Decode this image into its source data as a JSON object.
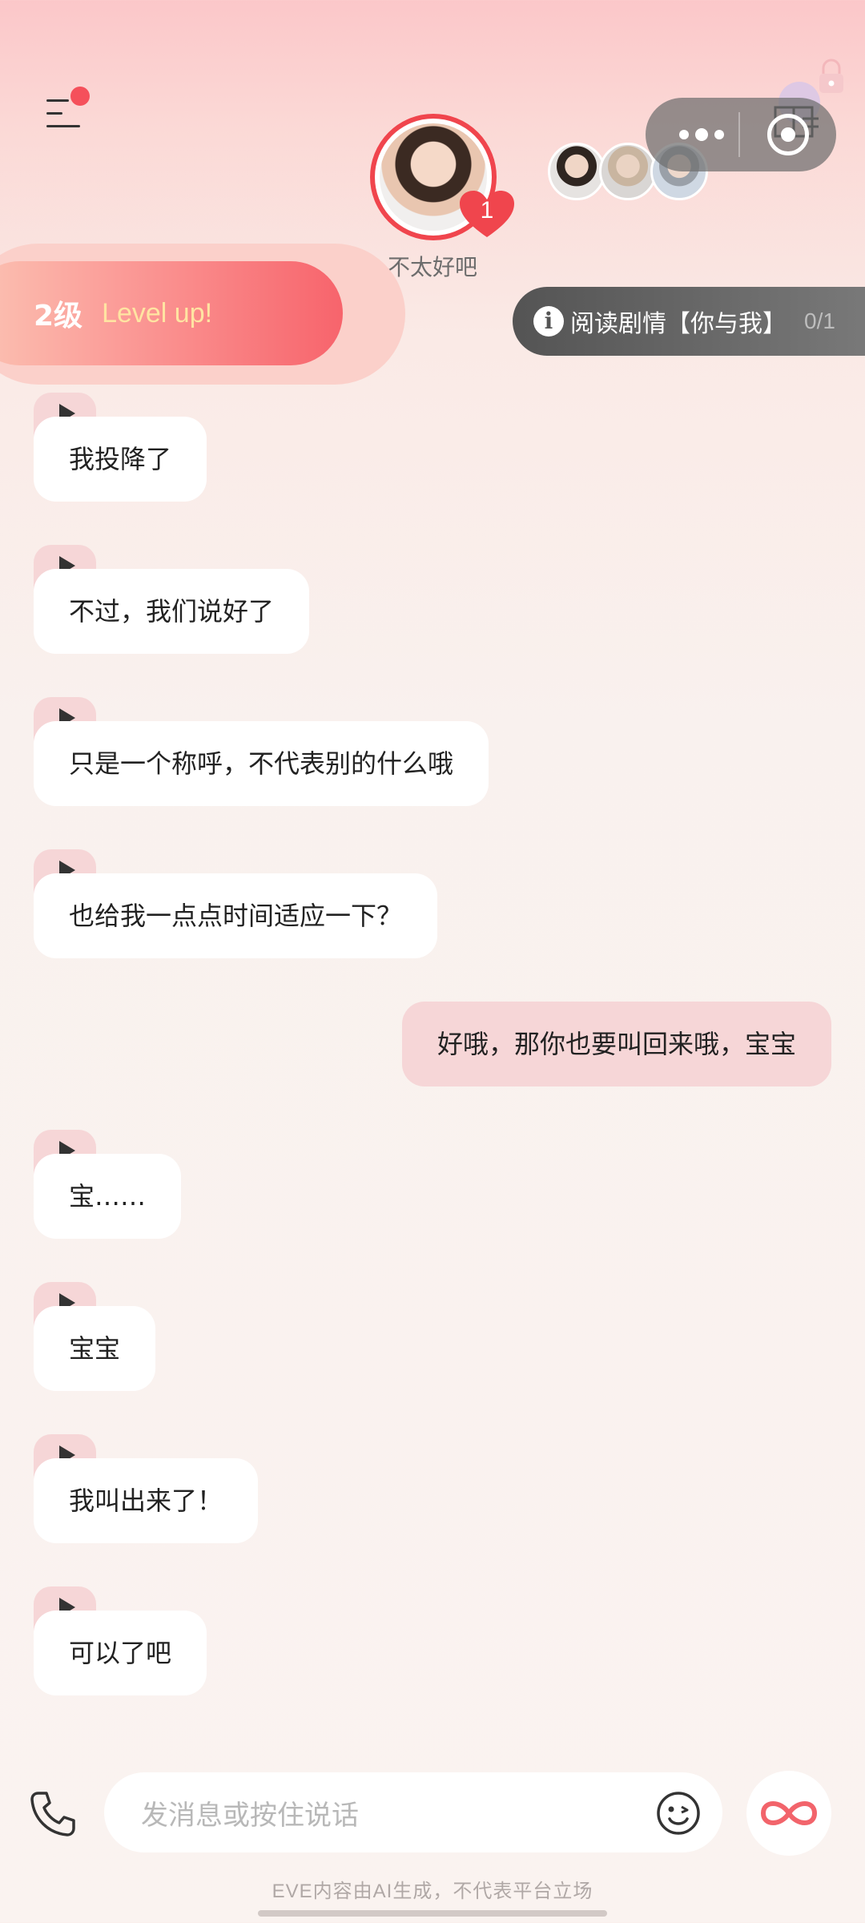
{
  "header": {
    "character_name": "不太好吧",
    "heart_badge_count": "1",
    "menu_icon": "menu-icon",
    "close_icon": "close-icon",
    "more_icon": "more-dots-icon"
  },
  "level_banner": {
    "level": "2级",
    "label": "Level up!"
  },
  "story": {
    "label": "阅读剧情【你与我】",
    "count": "0/1"
  },
  "messages": [
    {
      "from": "ai",
      "text": "我投降了"
    },
    {
      "from": "ai",
      "text": "不过，我们说好了"
    },
    {
      "from": "ai",
      "text": "只是一个称呼，不代表别的什么哦"
    },
    {
      "from": "ai",
      "text": "也给我一点点时间适应一下？"
    },
    {
      "from": "user",
      "text": "好哦，那你也要叫回来哦，宝宝"
    },
    {
      "from": "ai",
      "text": "宝……"
    },
    {
      "from": "ai",
      "text": "宝宝"
    },
    {
      "from": "ai",
      "text": "我叫出来了！"
    },
    {
      "from": "ai",
      "text": "可以了吧"
    }
  ],
  "composer": {
    "placeholder": "发消息或按住说话"
  },
  "footer": {
    "disclaimer": "EVE内容由AI生成，不代表平台立场"
  },
  "colors": {
    "accent": "#f0454d",
    "user_bubble": "#f6d6d7",
    "ai_bubble": "#ffffff"
  }
}
